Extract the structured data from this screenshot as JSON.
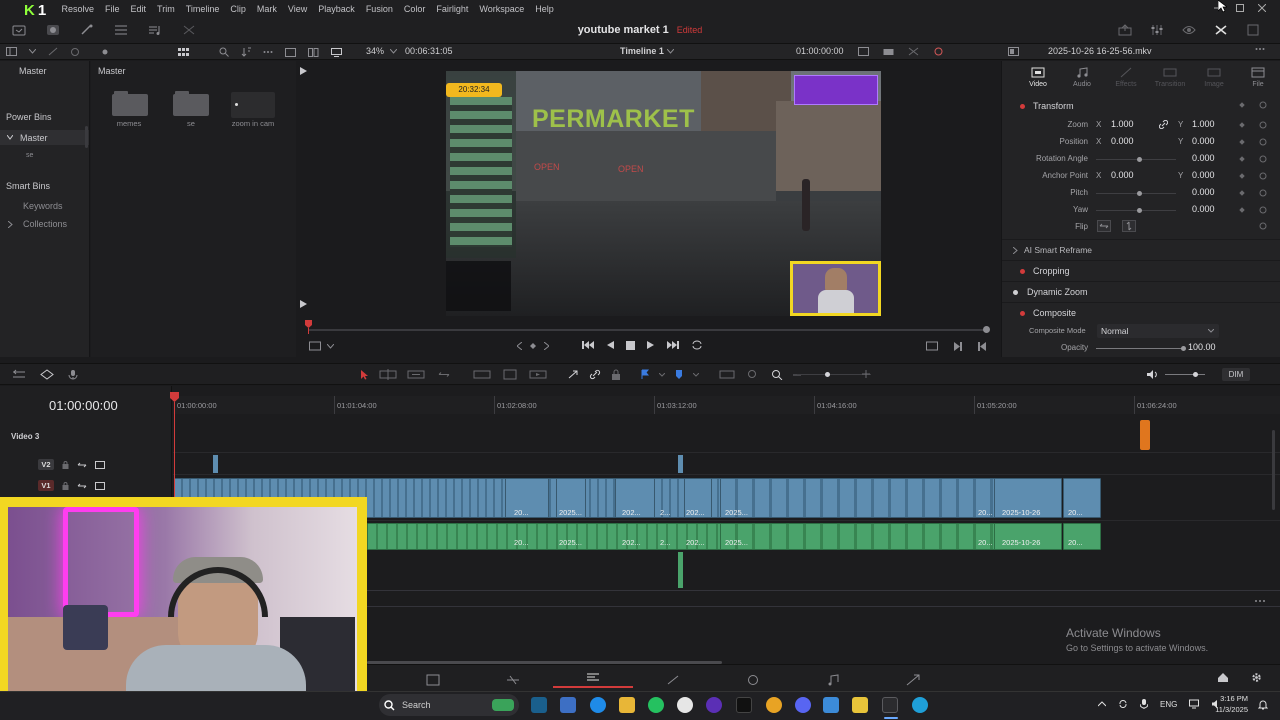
{
  "app": {
    "project_title": "youtube market 1",
    "edited_label": "Edited",
    "menu": [
      "Resolve",
      "File",
      "Edit",
      "Trim",
      "Timeline",
      "Clip",
      "Mark",
      "View",
      "Playback",
      "Fusion",
      "Color",
      "Fairlight",
      "Workspace",
      "Help"
    ],
    "logo_text_1": "K",
    "logo_text_2": "1"
  },
  "subbar": {
    "zoom": "34%",
    "duration": "00:06:31:05",
    "timeline_name": "Timeline 1",
    "timecode": "01:00:00:00",
    "clip_name": "2025-10-26 16-25-56.mkv"
  },
  "media_pool": {
    "left_header": "Master",
    "main_header": "Master",
    "power_bins": "Power Bins",
    "master_item": "Master",
    "master_sub": "se",
    "smart_bins": "Smart Bins",
    "keywords": "Keywords",
    "collections": "Collections",
    "bins": [
      {
        "label": "memes",
        "kind": "folder"
      },
      {
        "label": "se",
        "kind": "folder"
      },
      {
        "label": "zoom in cam",
        "kind": "clip"
      }
    ]
  },
  "viewer": {
    "overlay_time": "20:32:34",
    "sign_text": "PERMARKET",
    "open_1": "OPEN",
    "open_2": "OPEN"
  },
  "inspector": {
    "tabs": [
      "Video",
      "Audio",
      "Effects",
      "Transition",
      "Image",
      "File"
    ],
    "transform_title": "Transform",
    "rows": [
      {
        "label": "Zoom",
        "x": "1.000",
        "y": "1.000"
      },
      {
        "label": "Position",
        "x": "0.000",
        "y": "0.000"
      },
      {
        "label": "Rotation Angle",
        "value": "0.000",
        "level": 0.5
      },
      {
        "label": "Anchor Point",
        "x": "0.000",
        "y": "0.000"
      },
      {
        "label": "Pitch",
        "value": "0.000",
        "level": 0.5
      },
      {
        "label": "Yaw",
        "value": "0.000",
        "level": 0.5
      },
      {
        "label": "Flip"
      }
    ],
    "ai_reframe": "AI Smart Reframe",
    "cropping": "Cropping",
    "dynamic_zoom": "Dynamic Zoom",
    "composite": "Composite",
    "composite_mode_label": "Composite Mode",
    "composite_mode_value": "Normal",
    "opacity_label": "Opacity",
    "opacity_value": "100.00",
    "opacity_level": 1.0,
    "x_label": "X",
    "y_label": "Y"
  },
  "timeline": {
    "timecode": "01:00:00:00",
    "dim_label": "DIM",
    "ruler": [
      "01:00:00:00",
      "01:01:04:00",
      "01:02:08:00",
      "01:03:12:00",
      "01:04:16:00",
      "01:05:20:00",
      "01:06:24:00"
    ],
    "tracks": [
      {
        "name": "Video 3",
        "badge": ""
      },
      {
        "name": "",
        "badge": "V2"
      },
      {
        "name": "",
        "badge": "V1"
      }
    ],
    "video_labels": [
      "20...",
      "2025...",
      "202...",
      "2...",
      "202...",
      "2025...",
      "20...",
      "2025-10-26",
      "20..."
    ],
    "audio_labels": [
      "20...",
      "2025...",
      "202...",
      "2...",
      "202...",
      "2025...",
      "20...",
      "2025-10-26",
      "20..."
    ]
  },
  "taskbar": {
    "search_placeholder": "Search",
    "lang": "ENG",
    "time": "3:16 PM",
    "date": "11/3/2025"
  },
  "watermark": {
    "title": "Activate Windows",
    "subtitle": "Go to Settings to activate Windows."
  },
  "colors": {
    "accent_red": "#d23b3b",
    "clip_video": "#5e8db0",
    "clip_audio": "#4aa36b",
    "webcam_border": "#f2d722"
  }
}
